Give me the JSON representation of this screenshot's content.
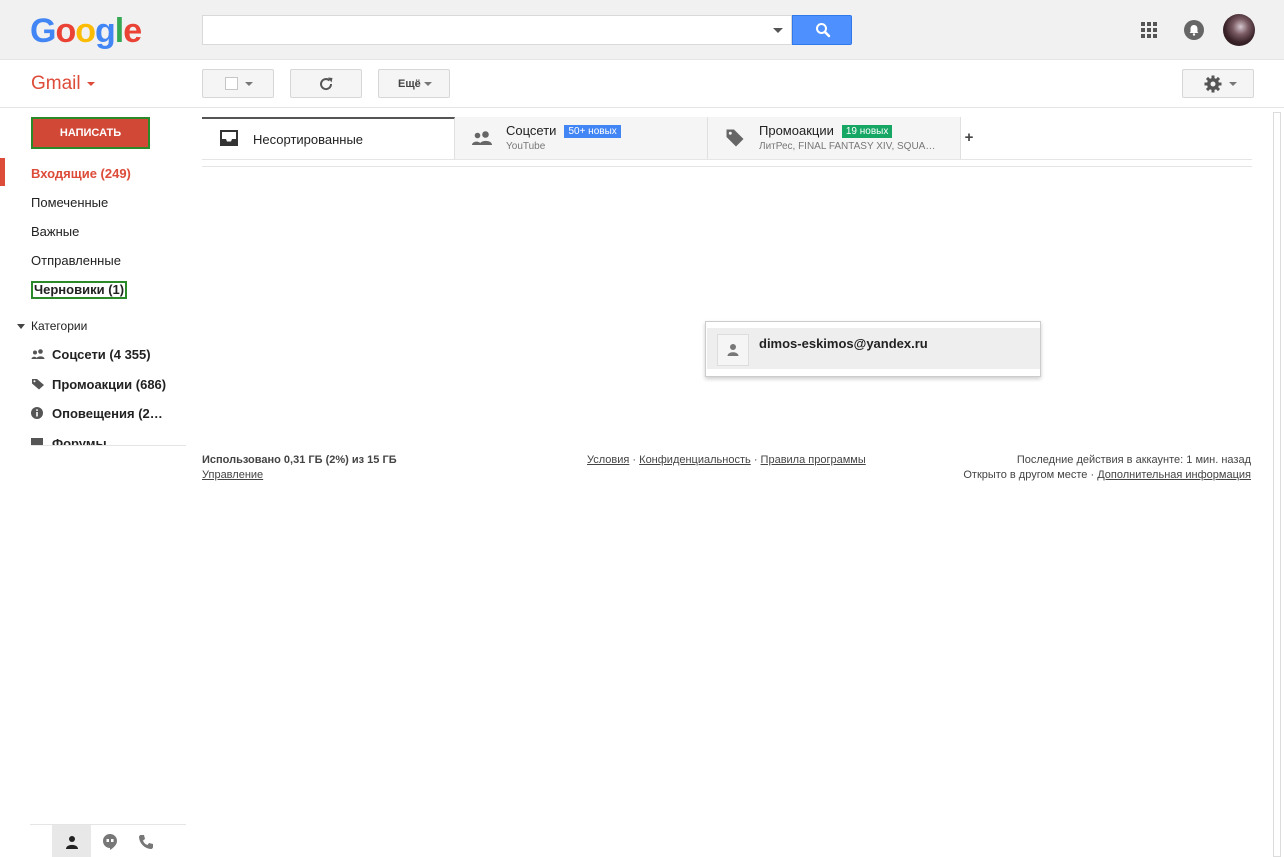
{
  "brand": {
    "logo_letters": [
      "G",
      "o",
      "o",
      "g",
      "l",
      "e"
    ],
    "logo_colors": [
      "#4285f4",
      "#ea4335",
      "#fbbc05",
      "#4285f4",
      "#34a853",
      "#ea4335"
    ],
    "app_label": "Gmail",
    "accent": "#dd4b39"
  },
  "search": {
    "value": "",
    "placeholder": ""
  },
  "toolbar": {
    "more_label": "Ещё"
  },
  "compose": {
    "label": "НАПИСАТЬ"
  },
  "nav": {
    "inbox": "Входящие (249)",
    "starred": "Помеченные",
    "important": "Важные",
    "sent": "Отправленные",
    "drafts": "Черновики (1)"
  },
  "categories": {
    "toggle": "Категории",
    "items": [
      {
        "label": "Соцсети (4 355)",
        "icon": "people-icon"
      },
      {
        "label": "Промоакции (686)",
        "icon": "tag-icon"
      },
      {
        "label": "Оповещения (2…",
        "icon": "info-icon"
      },
      {
        "label": "Форумы",
        "icon": "forum-icon"
      }
    ]
  },
  "tabs": [
    {
      "title": "Несортированные",
      "sub": "",
      "badge": "",
      "icon": "inbox-icon"
    },
    {
      "title": "Соцсети",
      "sub": "YouTube",
      "badge": "50+ новых",
      "badge_color": "#4285f4",
      "icon": "people-icon"
    },
    {
      "title": "Промоакции",
      "sub": "ЛитРес, FINAL FANTASY XIV, SQUA…",
      "badge": "19 новых",
      "badge_color": "#16a765",
      "icon": "tag-icon"
    }
  ],
  "add_tab": "+",
  "popup": {
    "email": "dimos-eskimos@yandex.ru"
  },
  "footer": {
    "storage": "Использовано 0,31 ГБ (2%) из 15 ГБ",
    "manage": "Управление",
    "terms": "Условия",
    "privacy": "Конфиденциальность",
    "policies": "Правила программы",
    "sep": "·",
    "last_activity": "Последние действия в аккаунте: 1 мин. назад",
    "open_elsewhere": "Открыто в другом месте",
    "details": "Дополнительная информация"
  }
}
